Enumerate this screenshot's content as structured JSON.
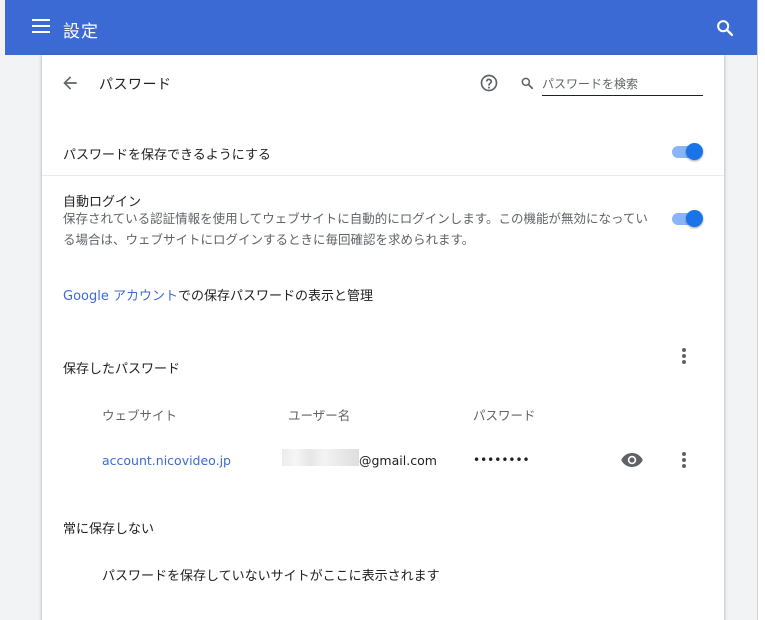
{
  "header": {
    "title": "設定",
    "menu_icon": "hamburger-menu-icon",
    "search_icon": "search-icon",
    "color": "#3c6ad4"
  },
  "passwords_page": {
    "title": "パスワード",
    "back_icon": "arrow-back-icon",
    "help_icon": "help-icon",
    "search": {
      "placeholder": "パスワードを検索",
      "value": ""
    }
  },
  "settings": {
    "offer_to_save": {
      "label": "パスワードを保存できるようにする",
      "enabled": true
    },
    "auto_signin": {
      "label": "自動ログイン",
      "description": "保存されている認証情報を使用してウェブサイトに自動的にログインします。この機能が無効になっている場合は、ウェブサイトにログインするときに毎回確認を求められます。",
      "enabled": true
    }
  },
  "manage": {
    "link_text": "Google アカウント",
    "rest_text": "での保存パスワードの表示と管理"
  },
  "saved_passwords": {
    "title": "保存したパスワード",
    "columns": [
      "ウェブサイト",
      "ユーザー名",
      "パスワード"
    ],
    "rows": [
      {
        "website": "account.nicovideo.jp",
        "username": "@gmail.com",
        "password": "••••••••"
      }
    ]
  },
  "never_saved": {
    "title": "常に保存しない",
    "empty_message": "パスワードを保存していないサイトがここに表示されます"
  }
}
